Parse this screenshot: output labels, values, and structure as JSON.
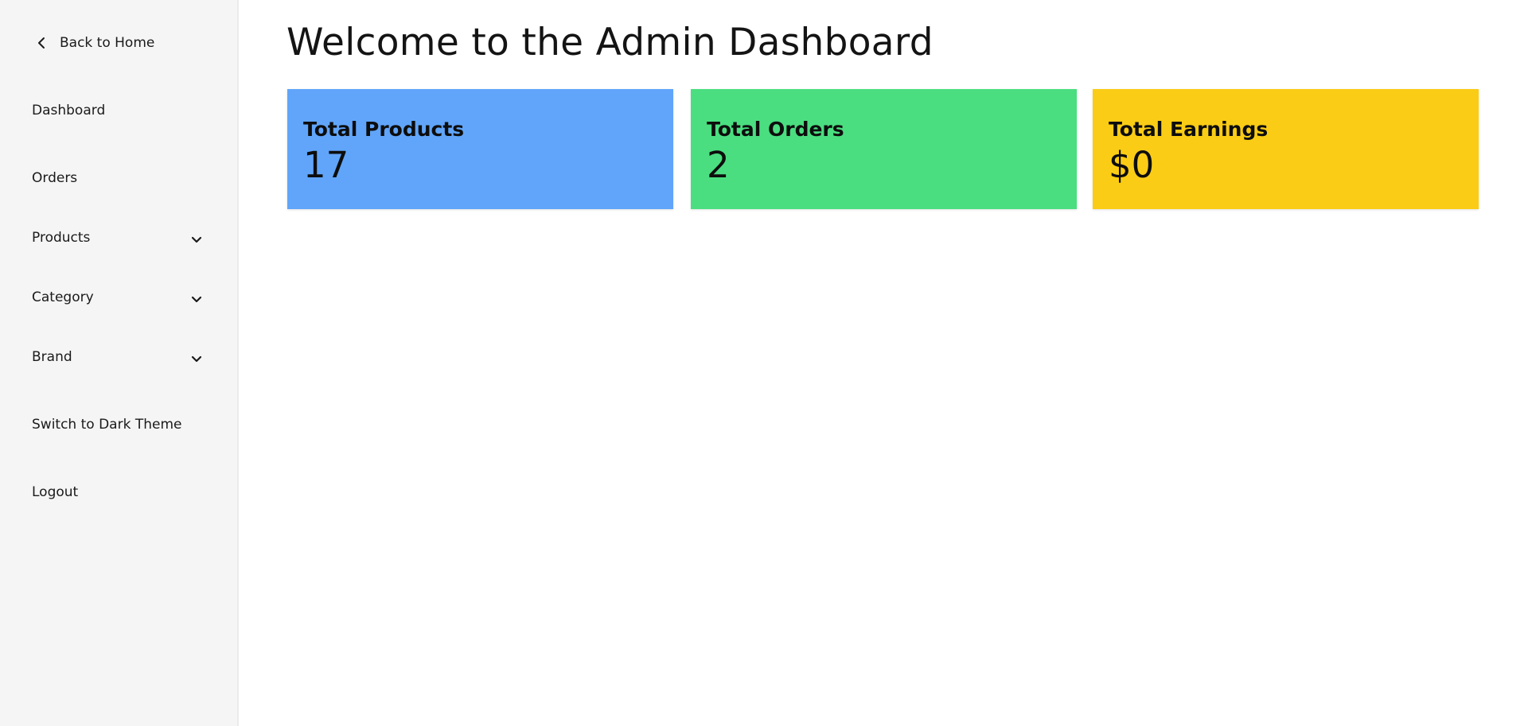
{
  "sidebar": {
    "back_link": {
      "label": "Back to Home",
      "icon": "chevron-left-icon"
    },
    "items": [
      {
        "label": "Dashboard",
        "has_submenu": false
      },
      {
        "label": "Orders",
        "has_submenu": false
      },
      {
        "label": "Products",
        "has_submenu": true,
        "icon": "chevron-down-icon"
      },
      {
        "label": "Category",
        "has_submenu": true,
        "icon": "chevron-down-icon"
      },
      {
        "label": "Brand",
        "has_submenu": true,
        "icon": "chevron-down-icon"
      },
      {
        "label": "Switch to Dark Theme",
        "has_submenu": false
      },
      {
        "label": "Logout",
        "has_submenu": false
      }
    ]
  },
  "main": {
    "title": "Welcome to the Admin Dashboard",
    "cards": [
      {
        "title": "Total Products",
        "value": "17",
        "color": "#60a5fa"
      },
      {
        "title": "Total Orders",
        "value": "2",
        "color": "#4ade80"
      },
      {
        "title": "Total Earnings",
        "value": "$0",
        "color": "#facc15"
      }
    ]
  },
  "colors": {
    "sidebar_bg": "#f5f5f5",
    "main_bg": "#ffffff",
    "text": "#111111"
  }
}
